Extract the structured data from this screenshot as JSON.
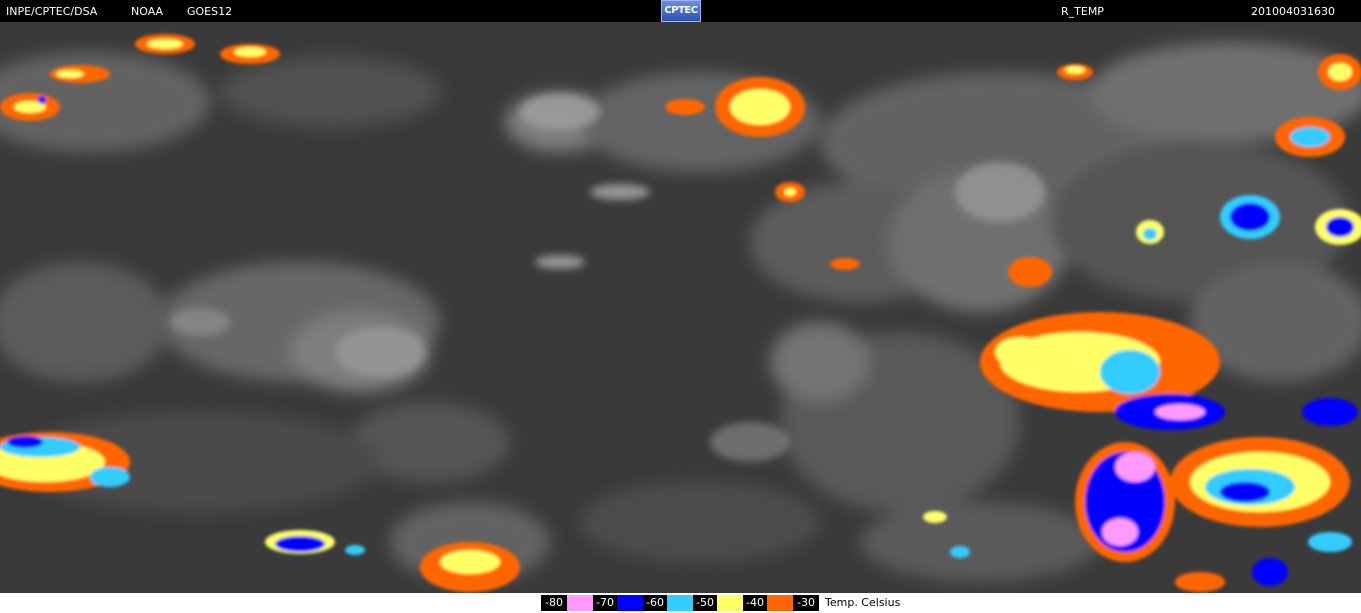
{
  "header": {
    "source": "INPE/CPTEC/DSA",
    "agency": "NOAA",
    "satellite": "GOES12",
    "logo_text": "CPTEC",
    "product": "R_TEMP",
    "timestamp": "201004031630"
  },
  "legend": {
    "items": [
      {
        "label": "-80",
        "color": "#ff99ff"
      },
      {
        "label": "-70",
        "color": "#ff99ff"
      },
      {
        "label": "-60",
        "color": "#0000ff"
      },
      {
        "label": "-50",
        "color": "#33ccff"
      },
      {
        "label": "-40",
        "color": "#ffff66"
      },
      {
        "label": "-30",
        "color": "#ff6600"
      }
    ],
    "unit": "Temp. Celsius"
  }
}
